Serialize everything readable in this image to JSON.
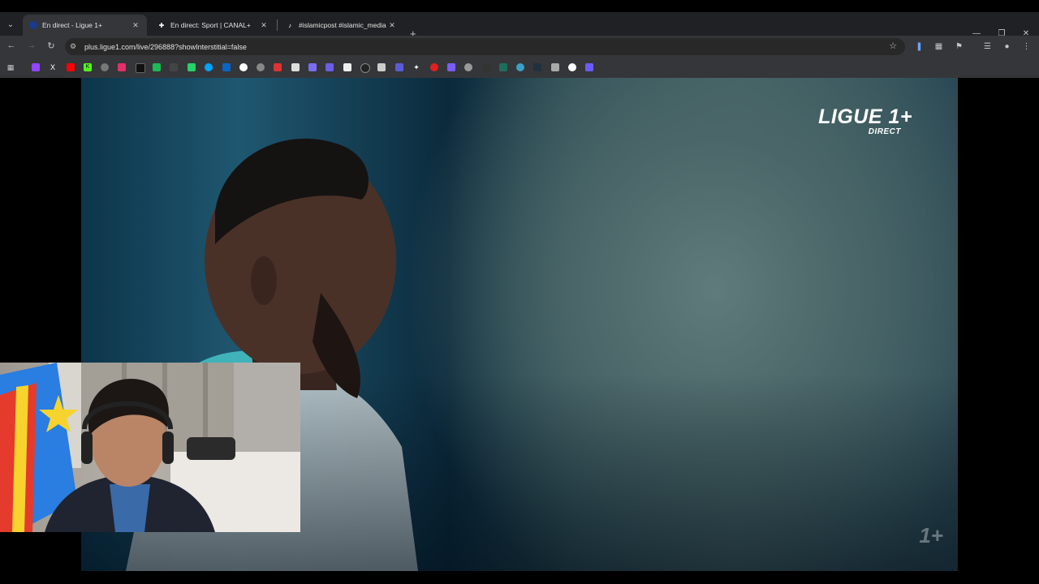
{
  "browser": {
    "tabs": [
      {
        "title": "En direct - Ligue 1+",
        "active": true,
        "favicon_color": "#1a73e8"
      },
      {
        "title": "En direct: Sport | CANAL+",
        "active": false,
        "favicon_color": "#000000"
      },
      {
        "title": "#islamicpost #islamic_media #",
        "active": false,
        "favicon_color": "#000000"
      }
    ],
    "url": "plus.ligue1.com/live/296888?showInterstitial=false"
  },
  "video": {
    "logo_main": "LIGUE 1+",
    "logo_sub": "DIRECT",
    "watermark": "1+"
  },
  "colors": {
    "tab_bg": "#202124",
    "toolbar_bg": "#35363a",
    "accent": "#1a73e8"
  }
}
